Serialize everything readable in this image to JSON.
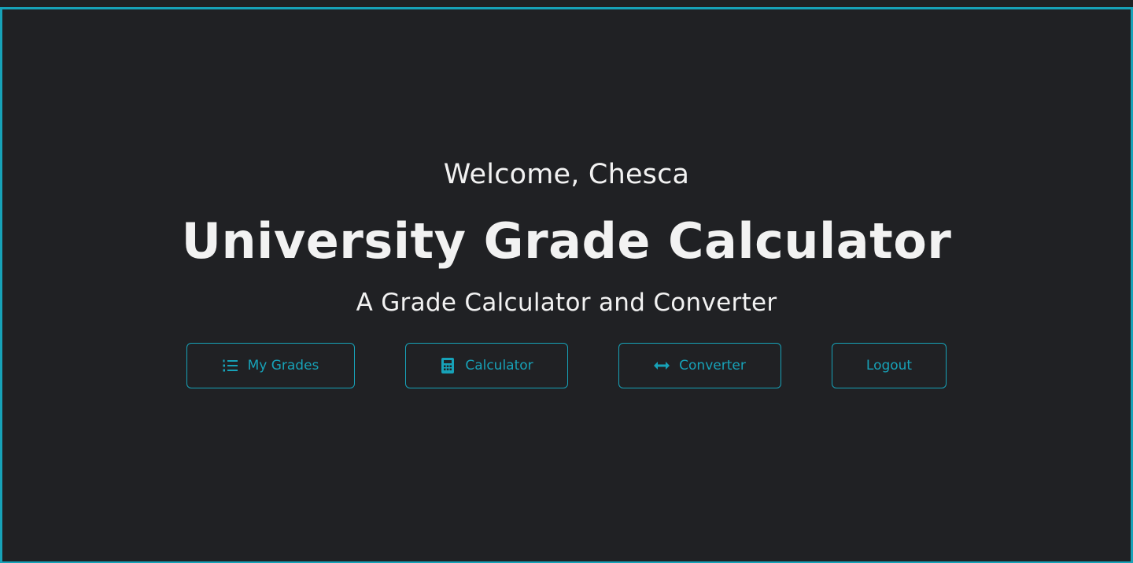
{
  "colors": {
    "background": "#202124",
    "accent": "#17a2b8",
    "text": "#f2f2f2"
  },
  "hero": {
    "welcome": "Welcome, Chesca",
    "title": "University Grade Calculator",
    "subtitle": "A Grade Calculator and Converter"
  },
  "actions": {
    "my_grades": {
      "label": "My Grades",
      "icon": "list-ol-icon"
    },
    "calculator": {
      "label": "Calculator",
      "icon": "calculator-icon"
    },
    "converter": {
      "label": "Converter",
      "icon": "arrows-left-right-icon"
    },
    "logout": {
      "label": "Logout"
    }
  }
}
